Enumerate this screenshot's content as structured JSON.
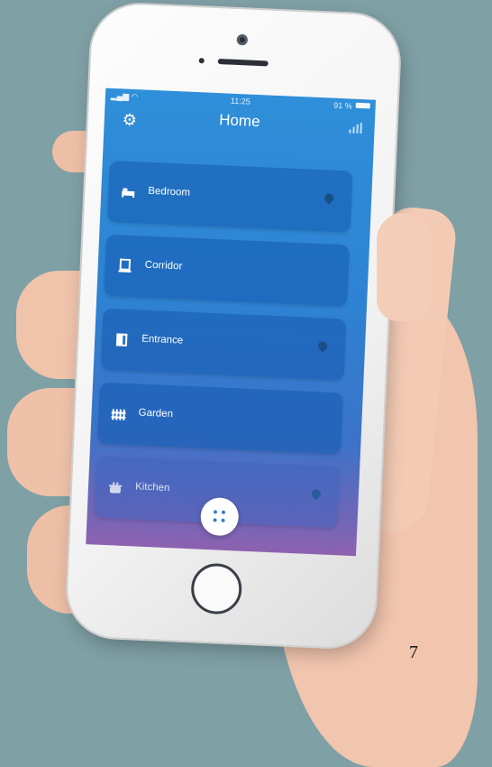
{
  "status_bar": {
    "time": "11:25",
    "battery": "91 %"
  },
  "nav": {
    "title": "Home",
    "settings_icon": "gear-icon",
    "stats_icon": "bar-chart-icon"
  },
  "rooms": [
    {
      "label": "Bedroom",
      "icon": "bed-icon",
      "pin": true
    },
    {
      "label": "Corridor",
      "icon": "lamp-icon",
      "pin": false
    },
    {
      "label": "Entrance",
      "icon": "door-icon",
      "pin": true
    },
    {
      "label": "Garden",
      "icon": "fence-icon",
      "pin": false
    },
    {
      "label": "Kitchen",
      "icon": "pot-icon",
      "pin": true
    }
  ],
  "fab_icon": "grid-dots-icon",
  "page_number": "7",
  "colors": {
    "background": "#7fa0a5",
    "screen_top": "#2f8fd9",
    "screen_bottom": "#8d62b0",
    "room_card": "#1f5fae"
  }
}
